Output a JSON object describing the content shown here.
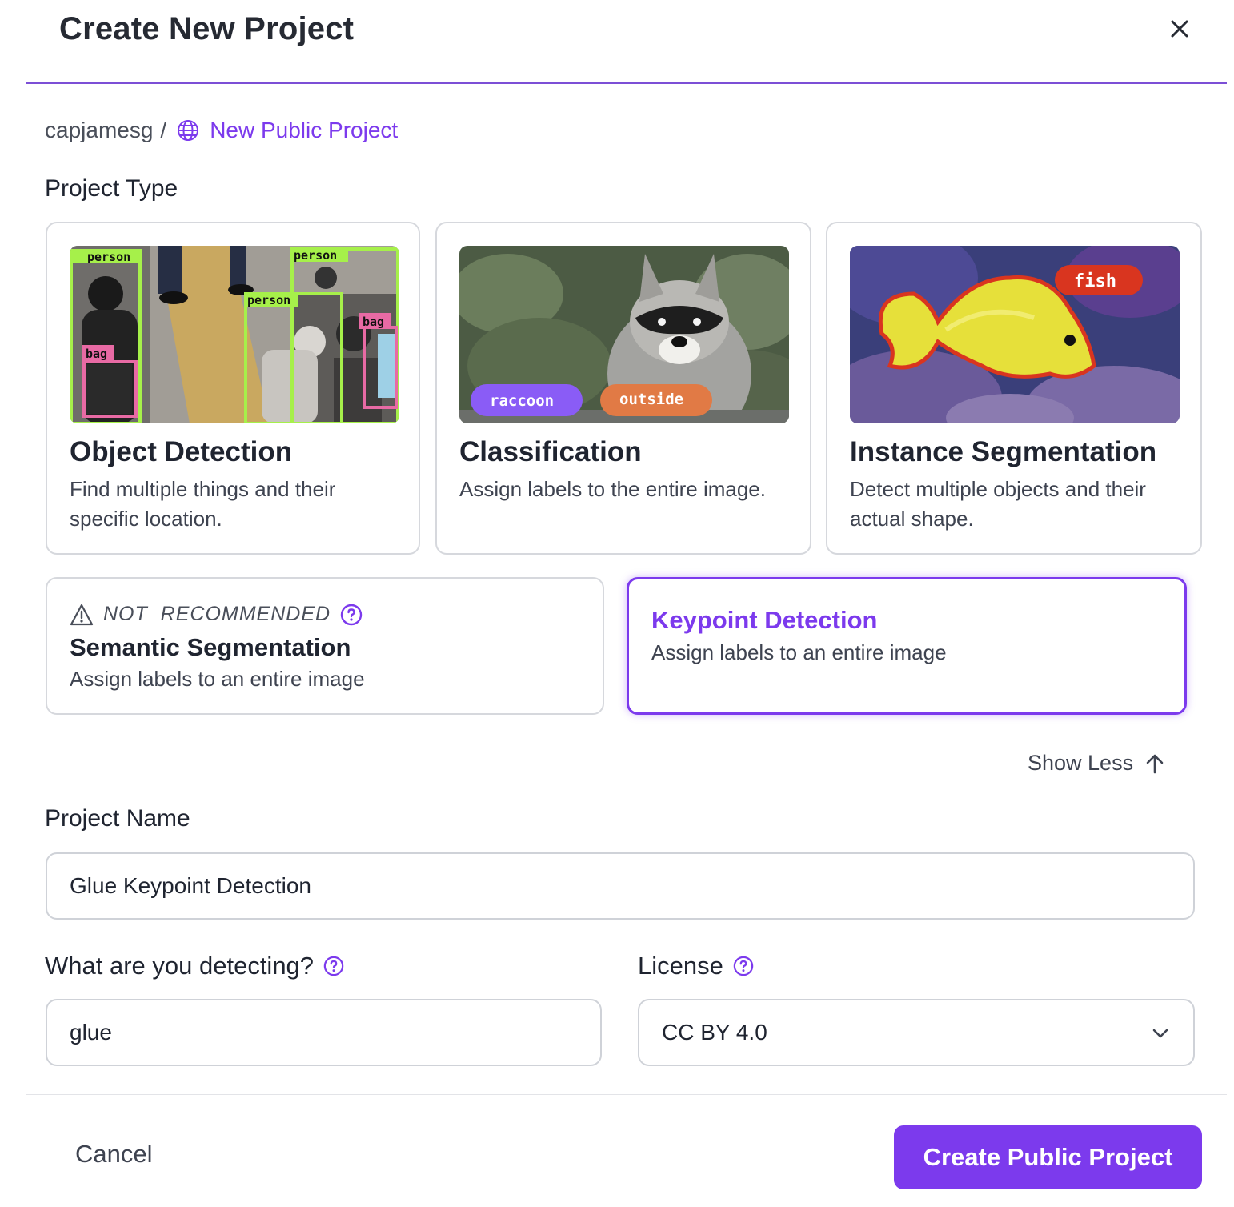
{
  "dialog": {
    "title": "Create New Project"
  },
  "breadcrumb": {
    "owner": "capjamesg",
    "separator": "/",
    "project": "New Public Project",
    "icon": "globe-icon"
  },
  "project_type": {
    "label": "Project Type",
    "cards": [
      {
        "title": "Object Detection",
        "description": "Find multiple things and their specific location.",
        "image_tags": [
          "person",
          "person",
          "person",
          "bag",
          "bag"
        ]
      },
      {
        "title": "Classification",
        "description": "Assign labels to the entire image.",
        "image_tags": [
          "raccoon",
          "outside"
        ]
      },
      {
        "title": "Instance Segmentation",
        "description": "Detect multiple objects and their actual shape.",
        "image_tags": [
          "fish"
        ]
      }
    ],
    "semantic": {
      "warning": "NOT  RECOMMENDED",
      "title": "Semantic Segmentation",
      "description": "Assign labels to an entire image"
    },
    "keypoint": {
      "title": "Keypoint Detection",
      "description": "Assign labels to an entire image",
      "selected": true
    },
    "show_less": "Show Less"
  },
  "project_name": {
    "label": "Project Name",
    "value": "Glue Keypoint Detection"
  },
  "detecting": {
    "label": "What are you detecting?",
    "value": "glue"
  },
  "license": {
    "label": "License",
    "value": "CC BY 4.0"
  },
  "footer": {
    "cancel": "Cancel",
    "create": "Create Public Project"
  },
  "colors": {
    "accent": "#7c3aed",
    "border": "#d6d8dd",
    "text": "#1f2430",
    "muted": "#3e4350"
  }
}
